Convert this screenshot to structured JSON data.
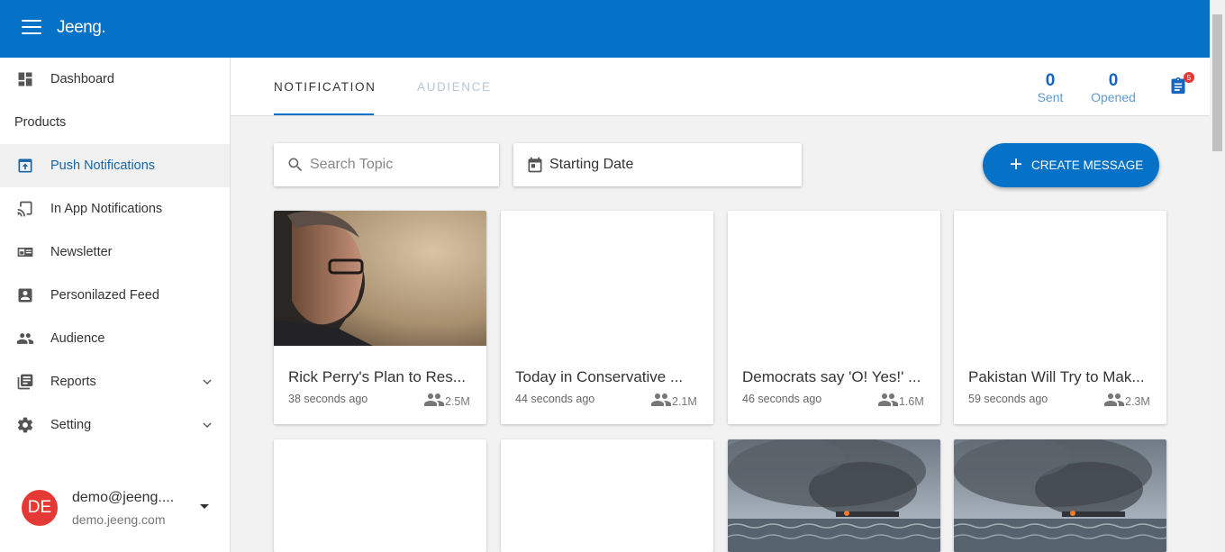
{
  "app": {
    "logo": "Jeeng."
  },
  "sidebar": {
    "items": [
      {
        "label": "Dashboard",
        "icon": "dashboard-icon"
      },
      {
        "label": "Push Notifications",
        "icon": "push-notification-icon",
        "active": true
      },
      {
        "label": "In App Notifications",
        "icon": "cast-icon"
      },
      {
        "label": "Newsletter",
        "icon": "newsletter-icon"
      },
      {
        "label": "Personilazed Feed",
        "icon": "account-box-icon"
      },
      {
        "label": "Audience",
        "icon": "people-icon"
      },
      {
        "label": "Reports",
        "icon": "reports-icon"
      },
      {
        "label": "Setting",
        "icon": "gear-icon"
      }
    ],
    "section_label": "Products",
    "user": {
      "initials": "DE",
      "email": "demo@jeeng....",
      "domain": "demo.jeeng.com"
    }
  },
  "tabs": [
    {
      "label": "NOTIFICATION",
      "active": true
    },
    {
      "label": "AUDIENCE",
      "active": false
    }
  ],
  "stats": {
    "sent": {
      "value": "0",
      "label": "Sent"
    },
    "opened": {
      "value": "0",
      "label": "Opened"
    },
    "badge": "5"
  },
  "filters": {
    "search_placeholder": "Search Topic",
    "date_label": "Starting Date",
    "create_label": "CREATE MESSAGE"
  },
  "cards": [
    {
      "title": "Rick Perry's Plan to Res...",
      "time": "38 seconds ago",
      "audience": "2.5M",
      "image": "portrait"
    },
    {
      "title": "Today in Conservative ...",
      "time": "44 seconds ago",
      "audience": "2.1M",
      "image": "none"
    },
    {
      "title": "Democrats say 'O! Yes!' ...",
      "time": "46 seconds ago",
      "audience": "1.6M",
      "image": "none"
    },
    {
      "title": "Pakistan Will Try to Mak...",
      "time": "59 seconds ago",
      "audience": "2.3M",
      "image": "none"
    },
    {
      "image": "none"
    },
    {
      "image": "none"
    },
    {
      "image": "smoke-sea"
    },
    {
      "image": "smoke-sea"
    }
  ],
  "colors": {
    "primary": "#0572c8",
    "badge": "#e53935",
    "active_text": "#1565a8"
  }
}
